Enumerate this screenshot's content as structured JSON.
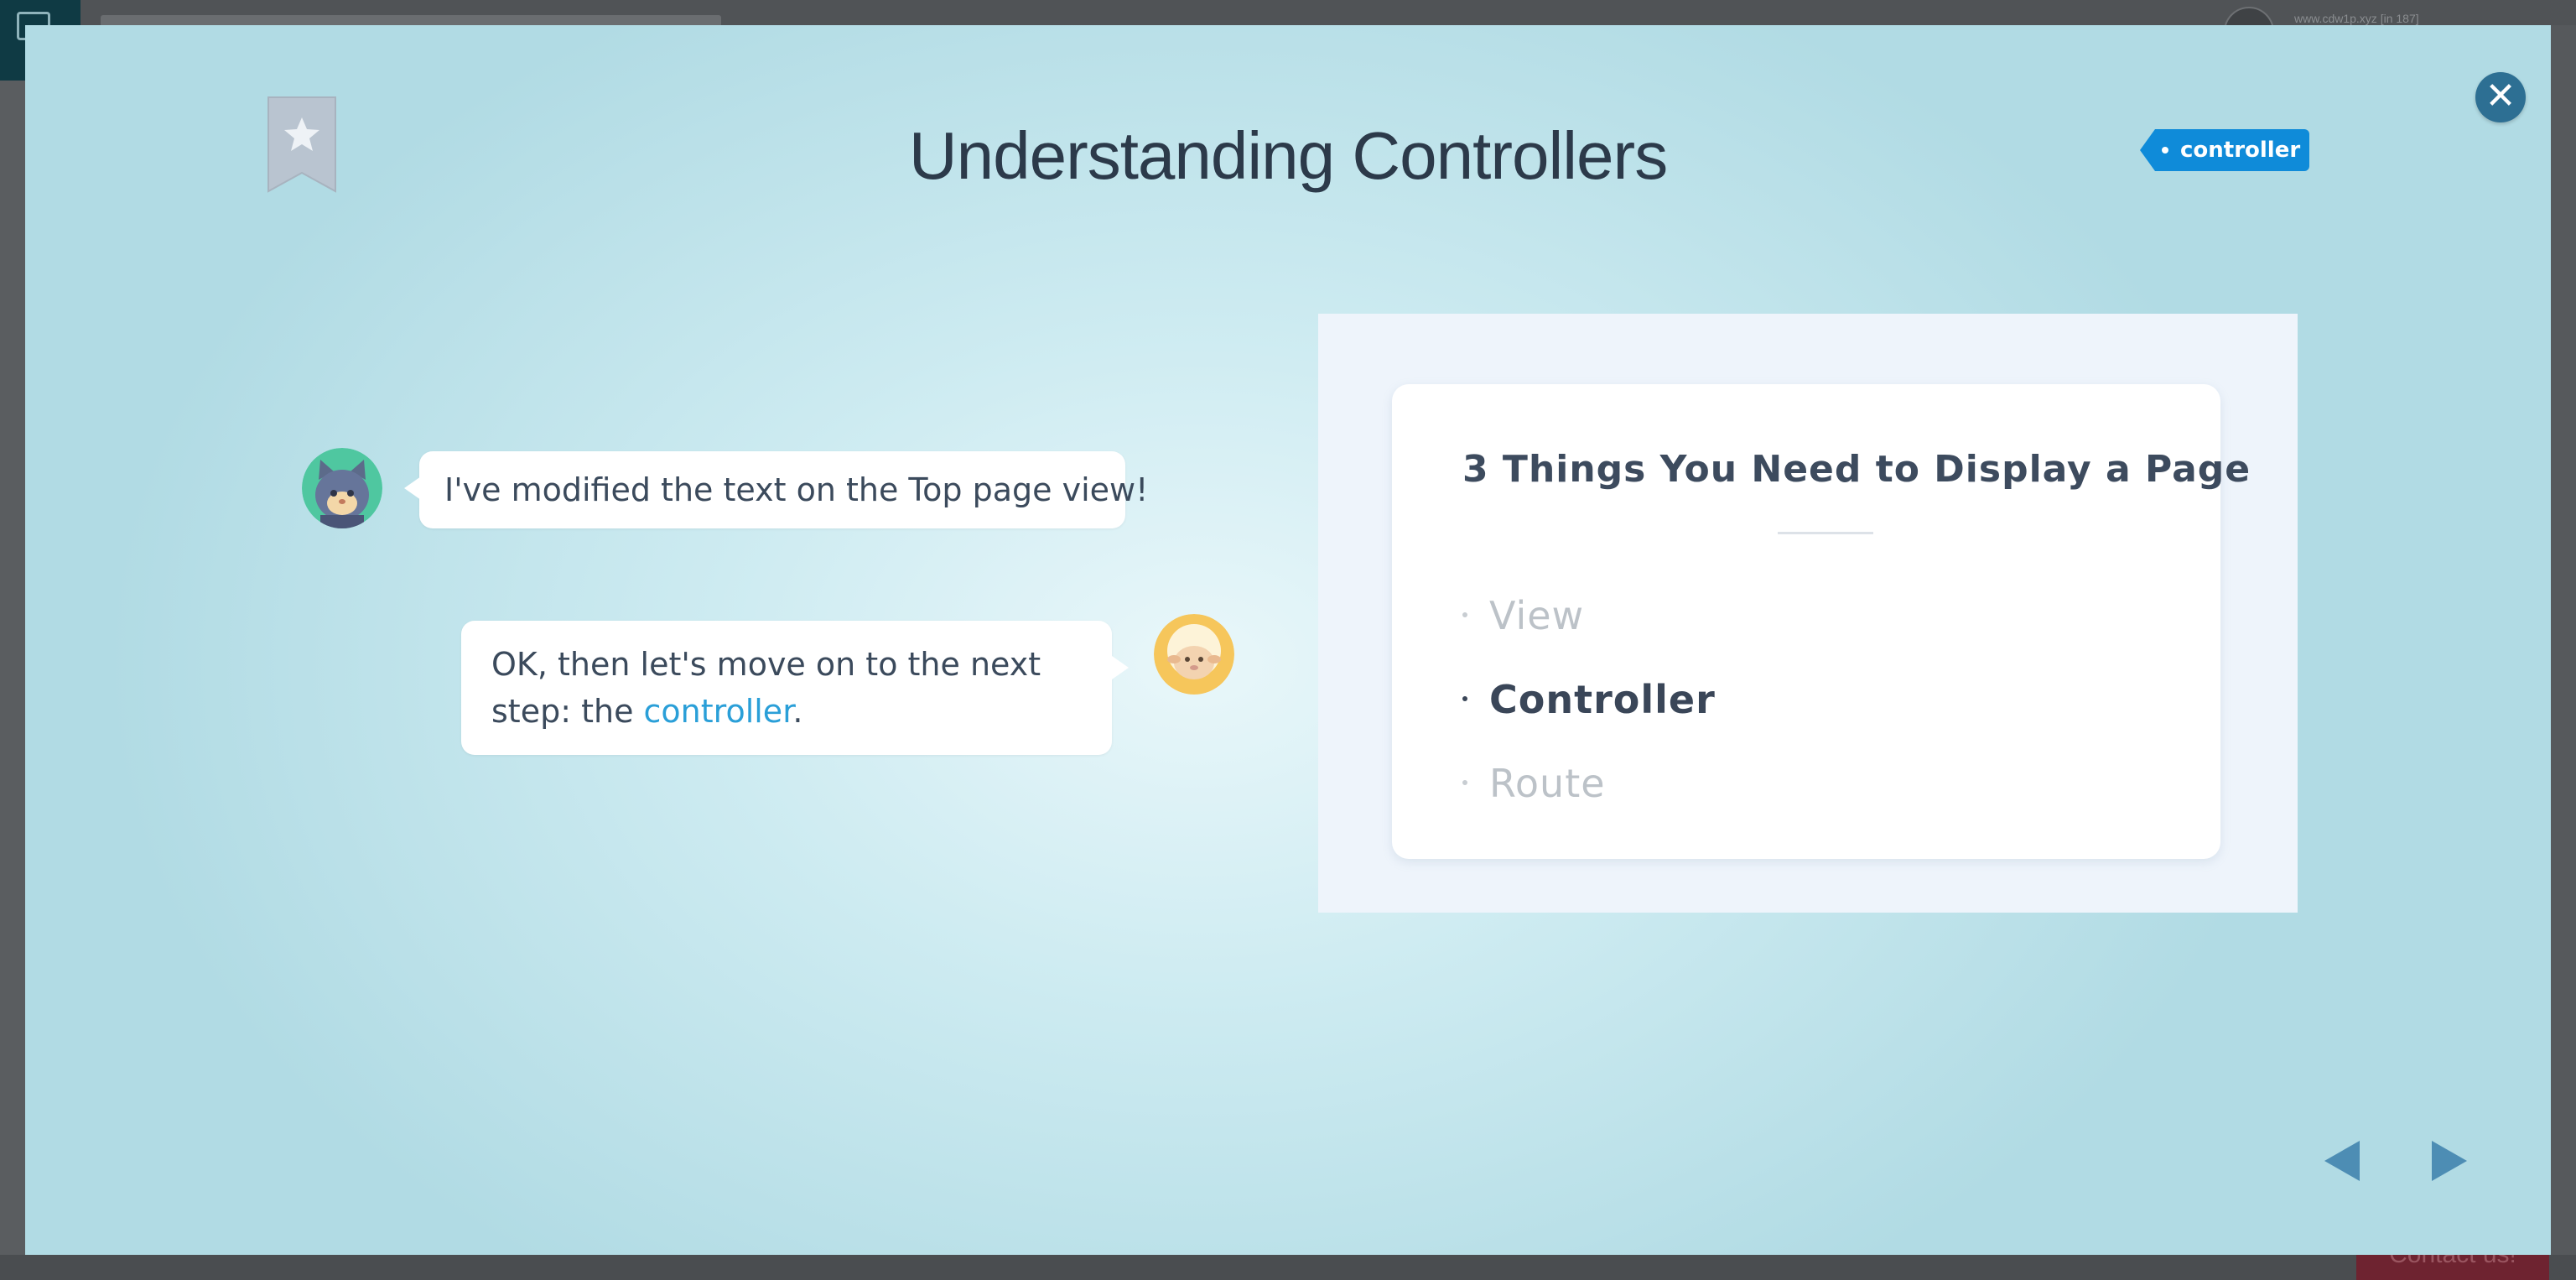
{
  "background": {
    "url_text": "www.cdw1p.xyz [in 187]",
    "contact_label": "Contact us!"
  },
  "modal": {
    "title": "Understanding Controllers",
    "tag_label": "controller",
    "close_icon": "close-icon",
    "bookmark_icon": "star-bookmark-icon"
  },
  "chat": {
    "message_1": "I've modified the text on the Top page view!",
    "message_2_prefix": "OK, then let's move on to the next step: the ",
    "message_2_link": "controller",
    "message_2_suffix": "."
  },
  "slide": {
    "title": "3 Things You Need to Display a Page",
    "items": [
      {
        "label": "View",
        "active": false
      },
      {
        "label": "Controller",
        "active": true
      },
      {
        "label": "Route",
        "active": false
      }
    ]
  },
  "navigation": {
    "prev_icon": "triangle-left-icon",
    "next_icon": "triangle-right-icon"
  },
  "colors": {
    "tag": "#0f8bd9",
    "close_button": "#2d6f93",
    "link": "#2a9fd8",
    "nav_arrow": "#4d8db4"
  }
}
